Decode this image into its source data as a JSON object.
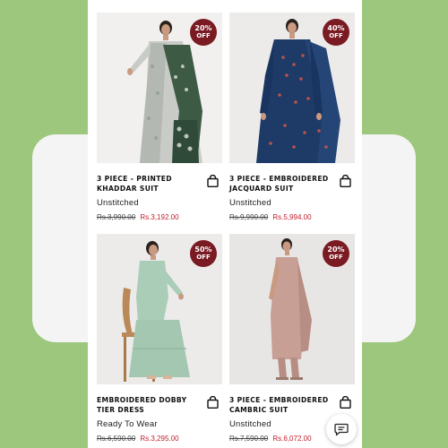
{
  "products": [
    {
      "badge_pct": "20%",
      "badge_off": "OFF",
      "title": "3 PIECE - PRINTED KHADDAR SUIT",
      "category": "Unstitched",
      "old_price": "Rs.3,990.00",
      "new_price": "Rs.3,192.00"
    },
    {
      "badge_pct": "40%",
      "badge_off": "OFF",
      "title": "3 PIECE - EMBROIDERED JACQUARD SUIT",
      "category": "Unstitched",
      "old_price": "Rs.9,990.00",
      "new_price": "Rs.5,994.00"
    },
    {
      "badge_pct": "50%",
      "badge_off": "OFF",
      "title": "EMBROIDERED DOBBY TIER DRESS",
      "category": "Ready To Wear",
      "old_price": "Rs.6,590.00",
      "new_price": "Rs.3,295.00"
    },
    {
      "badge_pct": "20%",
      "badge_off": "OFF",
      "title": "3 PIECE - EMBROIDERED CAMBRIC SUIT",
      "category": "Unstitched",
      "old_price": "Rs.7,590.00",
      "new_price": "Rs.6,072.00"
    }
  ],
  "icons": {
    "bag": "shopping-bag-icon",
    "chat": "chat-icon"
  },
  "colors": {
    "background": "#9cc77c",
    "badge": "#7a1a22",
    "sale_price": "#c0202e"
  }
}
